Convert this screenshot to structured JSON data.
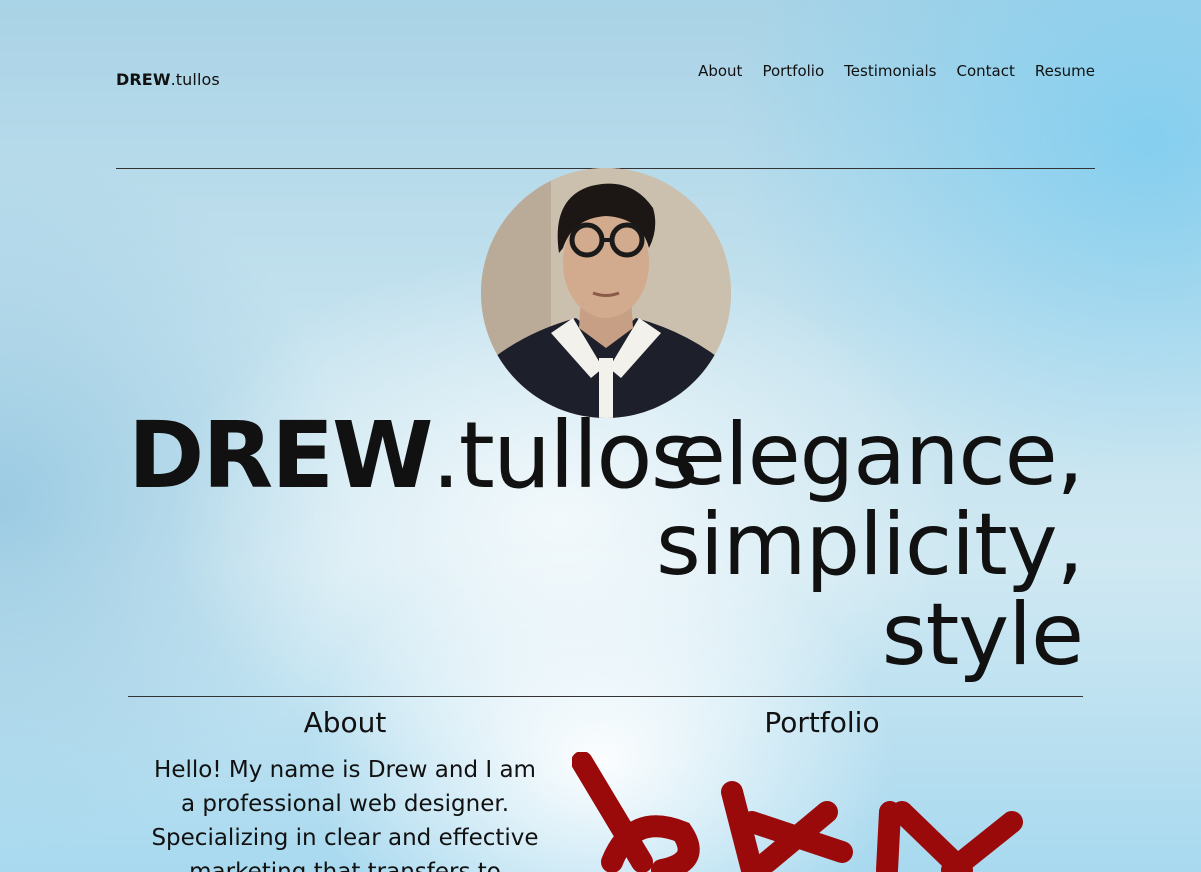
{
  "header": {
    "brand_bold": "DREW",
    "brand_rest": ".tullos",
    "nav": [
      "About",
      "Portfolio",
      "Testimonials",
      "Contact",
      "Resume"
    ]
  },
  "hero": {
    "name_bold": "DREW",
    "name_rest": ".tullos",
    "tagline": [
      "elegance,",
      "simplicity,",
      "style"
    ]
  },
  "about": {
    "heading": "About",
    "text": "Hello! My name is Drew and I am a professional web designer. Specializing in clear and effective marketing that transfers to"
  },
  "portfolio": {
    "heading": "Portfolio"
  },
  "colors": {
    "text": "#111111",
    "logo_red": "#9b0a0a"
  }
}
